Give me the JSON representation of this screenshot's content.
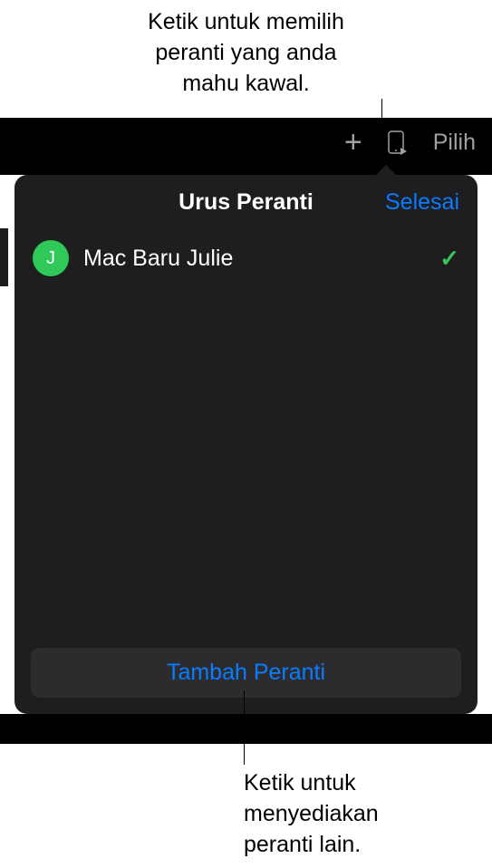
{
  "callouts": {
    "top": "Ketik untuk memilih\nperanti yang anda\nmahu kawal.",
    "top_line1": "Ketik untuk memilih",
    "top_line2": "peranti yang anda",
    "top_line3": "mahu kawal.",
    "bottom": "Ketik untuk\nmenyediakan\nperanti lain.",
    "bottom_line1": "Ketik untuk",
    "bottom_line2": "menyediakan",
    "bottom_line3": "peranti lain."
  },
  "toolbar": {
    "pilih_label": "Pilih"
  },
  "popover": {
    "title": "Urus Peranti",
    "done_label": "Selesai",
    "add_device_label": "Tambah Peranti"
  },
  "devices": [
    {
      "avatar_initial": "J",
      "name": "Mac Baru Julie",
      "selected": true
    }
  ]
}
